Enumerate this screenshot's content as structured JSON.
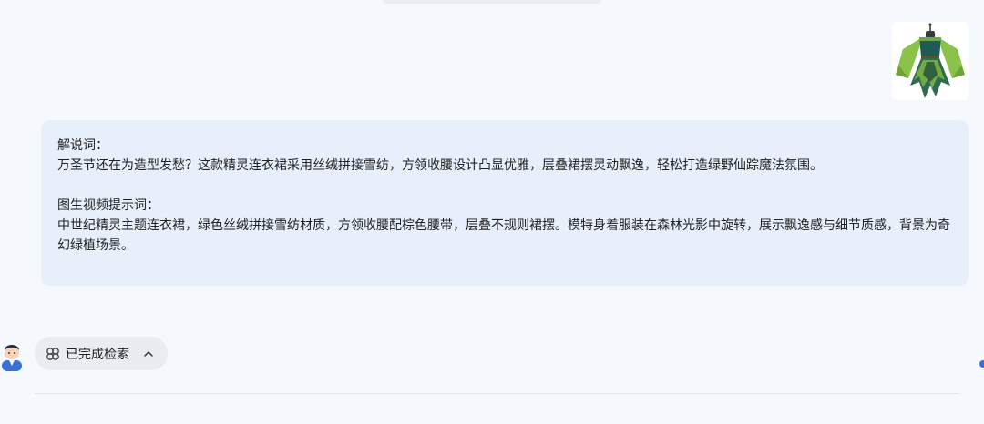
{
  "message": {
    "label_commentary": "解说词：",
    "commentary_text": "万圣节还在为造型发愁？这款精灵连衣裙采用丝绒拼接雪纺，方领收腰设计凸显优雅，层叠裙摆灵动飘逸，轻松打造绿野仙踪魔法氛围。",
    "label_prompt": "图生视频提示词：",
    "prompt_text": "中世纪精灵主题连衣裙，绿色丝绒拼接雪纺材质，方领收腰配棕色腰带，层叠不规则裙摆。模特身着服装在森林光影中旋转，展示飘逸感与细节质感，背景为奇幻绿植场景。"
  },
  "search_status": {
    "label": "已完成检索",
    "icon": "search-status-icon",
    "chevron": "chevron-up-icon"
  },
  "colors": {
    "page_bg": "#f5f9fe",
    "bubble_bg": "#e7effb",
    "pill_bg": "#e9edf2",
    "accent": "#2f6fe8",
    "dress_green": "#8bc34a",
    "dress_teal": "#1f5a55"
  }
}
